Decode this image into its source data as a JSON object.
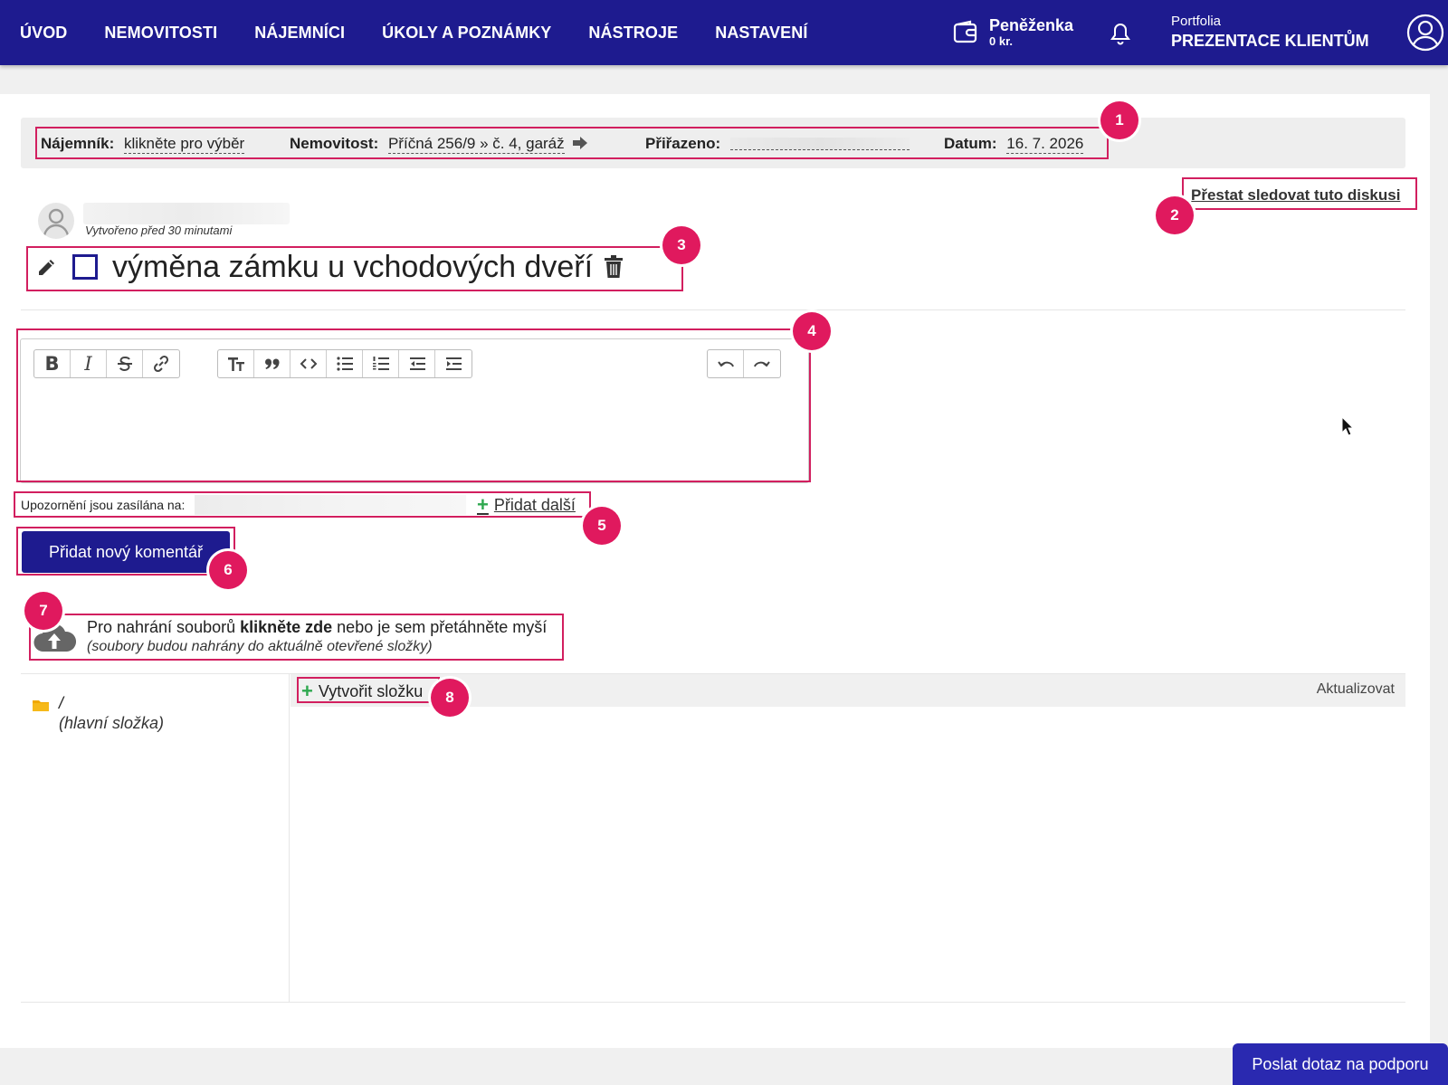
{
  "nav": {
    "items": [
      "ÚVOD",
      "NEMOVITOSTI",
      "NÁJEMNÍCI",
      "ÚKOLY A POZNÁMKY",
      "NÁSTROJE",
      "NASTAVENÍ"
    ]
  },
  "wallet": {
    "label": "Peněženka",
    "amount": "0 kr."
  },
  "portfolio": {
    "label": "Portfolia",
    "name": "PREZENTACE KLIENTŮM"
  },
  "info": {
    "tenant_label": "Nájemník:",
    "tenant_value": "klikněte pro výběr",
    "property_label": "Nemovitost:",
    "property_value": "Příčná 256/9 » č. 4, garáž",
    "assigned_label": "Přiřazeno:",
    "date_label": "Datum:",
    "date_value": "16. 7. 2026"
  },
  "discussion": {
    "unfollow": "Přestat sledovat tuto diskusi",
    "created": "Vytvořeno před 30 minutami",
    "title": "výměna zámku u vchodových dveří"
  },
  "editor": {
    "tools": [
      "bold",
      "italic",
      "strikethrough",
      "link",
      "heading",
      "quote",
      "code",
      "bullet-list",
      "numbered-list",
      "outdent",
      "indent",
      "undo",
      "redo"
    ],
    "bold_label": "B",
    "italic_label": "I"
  },
  "notify": {
    "label": "Upozornění jsou zasílána na:",
    "add_more": "Přidat další"
  },
  "comment_button": "Přidat nový komentář",
  "upload": {
    "text_before": "Pro nahrání souborů ",
    "text_bold": "klikněte zde",
    "text_after": " nebo je sem přetáhněte myší",
    "note": "(soubory budou nahrány do aktuálně otevřené složky)"
  },
  "files": {
    "root_name": "/",
    "root_label": "(hlavní složka)",
    "create_folder": "Vytvořit složku",
    "refresh": "Aktualizovat"
  },
  "support_button": "Poslat dotaz na podporu",
  "badges": [
    "1",
    "2",
    "3",
    "4",
    "5",
    "6",
    "7",
    "8"
  ],
  "colors": {
    "brand": "#1e1b8f",
    "highlight": "#d21f5f",
    "badge": "#e0195e",
    "plus": "#2fa84f"
  }
}
